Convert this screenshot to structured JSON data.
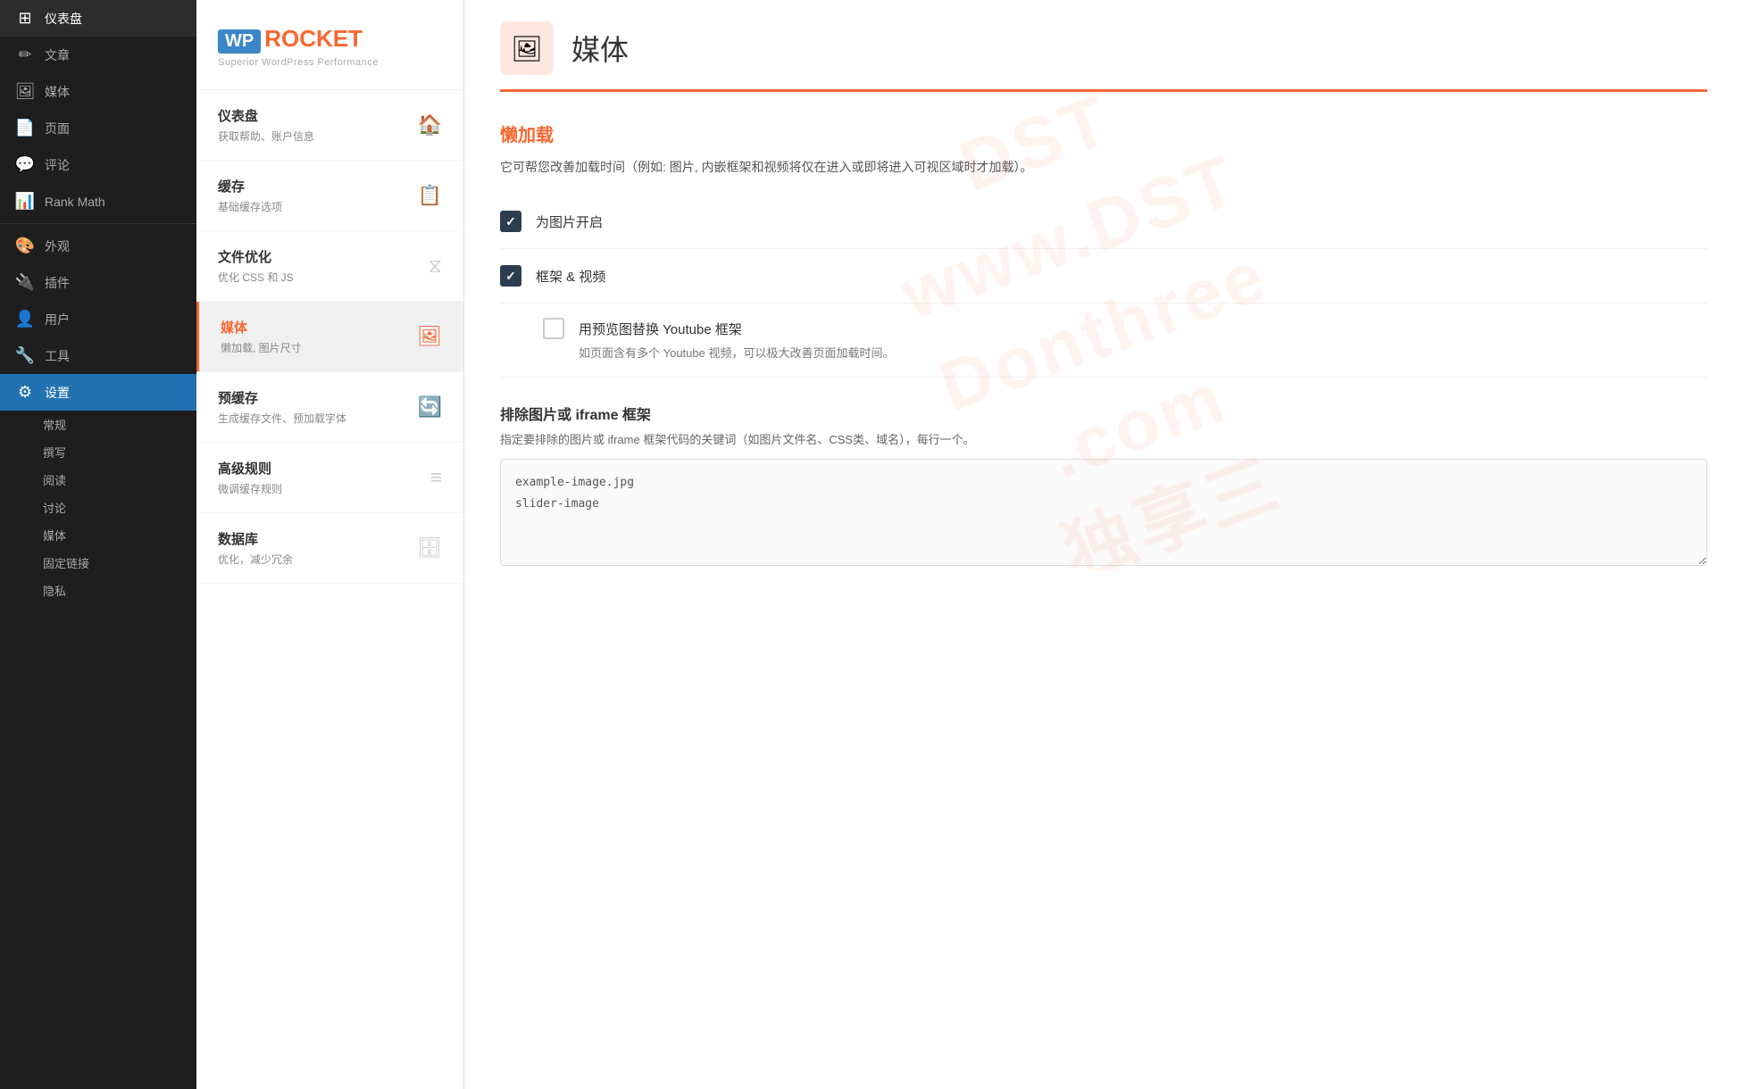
{
  "wp_sidebar": {
    "items": [
      {
        "id": "dashboard",
        "label": "仪表盘",
        "icon": "⊞"
      },
      {
        "id": "posts",
        "label": "文章",
        "icon": "✏"
      },
      {
        "id": "media",
        "label": "媒体",
        "icon": "🖼"
      },
      {
        "id": "pages",
        "label": "页面",
        "icon": "📄"
      },
      {
        "id": "comments",
        "label": "评论",
        "icon": "💬"
      },
      {
        "id": "rankmath",
        "label": "Rank Math",
        "icon": "📊"
      },
      {
        "id": "appearance",
        "label": "外观",
        "icon": "🎨"
      },
      {
        "id": "plugins",
        "label": "插件",
        "icon": "🔌"
      },
      {
        "id": "users",
        "label": "用户",
        "icon": "👤"
      },
      {
        "id": "tools",
        "label": "工具",
        "icon": "🔧"
      },
      {
        "id": "settings",
        "label": "设置",
        "icon": "⚙"
      }
    ],
    "settings_sub": [
      {
        "id": "general",
        "label": "常规"
      },
      {
        "id": "writing",
        "label": "撰写"
      },
      {
        "id": "reading",
        "label": "阅读"
      },
      {
        "id": "discussion",
        "label": "讨论"
      },
      {
        "id": "media",
        "label": "媒体"
      },
      {
        "id": "permalink",
        "label": "固定链接"
      },
      {
        "id": "privacy",
        "label": "隐私"
      }
    ]
  },
  "plugin_sidebar": {
    "logo": {
      "wp_text": "WP",
      "rocket_text": "ROCKET",
      "tagline": "Superior WordPress Performance"
    },
    "menu_items": [
      {
        "id": "dashboard",
        "title": "仪表盘",
        "subtitle": "获取帮助、账户信息",
        "icon": "🏠"
      },
      {
        "id": "cache",
        "title": "缓存",
        "subtitle": "基础缓存选项",
        "icon": "📋"
      },
      {
        "id": "file_optimize",
        "title": "文件优化",
        "subtitle": "优化 CSS 和 JS",
        "icon": "⧖"
      },
      {
        "id": "media",
        "title": "媒体",
        "subtitle": "懒加载, 图片尺寸",
        "icon": "🖼",
        "active": true
      },
      {
        "id": "preload",
        "title": "预缓存",
        "subtitle": "生成缓存文件、预加载字体",
        "icon": "🔄"
      },
      {
        "id": "advanced_rules",
        "title": "高级规则",
        "subtitle": "微调缓存规则",
        "icon": "≡"
      },
      {
        "id": "database",
        "title": "数据库",
        "subtitle": "优化，减少冗余",
        "icon": "🗄"
      }
    ]
  },
  "main": {
    "page_icon": "🖼",
    "page_title": "媒体",
    "lazy_load": {
      "section_title": "懒加载",
      "description": "它可帮您改善加载时间（例如: 图片, 内嵌框架和视频将仅在进入或即将进入可视区域时才加载）。",
      "options": [
        {
          "id": "images",
          "label": "为图片开启",
          "checked": true
        },
        {
          "id": "iframes_videos",
          "label": "框架 & 视频",
          "checked": true
        }
      ],
      "sub_options": [
        {
          "id": "youtube_preview",
          "label": "用预览图替换 Youtube 框架",
          "checked": false,
          "description": "如页面含有多个 Youtube 视频，可以极大改善页面加载时间。"
        }
      ]
    },
    "exclude_section": {
      "title": "排除图片或 iframe 框架",
      "description": "指定要排除的图片或 iframe 框架代码的关键词（如图片文件名、CSS类、域名），每行一个。",
      "placeholder": "example-image.jpg\nslider-image"
    }
  },
  "colors": {
    "accent": "#f96630",
    "checked_bg": "#2c3e50",
    "sidebar_bg": "#1e1e1e",
    "sidebar_text": "#a7aaad",
    "active_nav": "#2271b1"
  }
}
